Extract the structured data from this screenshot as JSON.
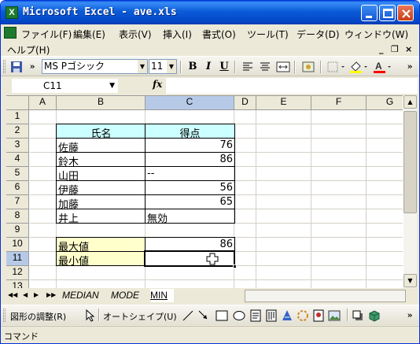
{
  "window": {
    "title": "Microsoft Excel - ave.xls",
    "app_icon_letter": "X"
  },
  "menu": {
    "items": [
      "ファイル(F)",
      "編集(E)",
      "表示(V)",
      "挿入(I)",
      "書式(O)",
      "ツール(T)",
      "データ(D)",
      "ウィンドウ(W)",
      "ヘルプ(H)"
    ],
    "doc_controls": [
      "_",
      "❐",
      "×"
    ]
  },
  "toolbar": {
    "font_name": "MS Pゴシック",
    "font_size": "11",
    "bold": "B",
    "italic": "I",
    "underline": "U",
    "more": "»"
  },
  "formula_bar": {
    "name_box": "C11",
    "fx": "fx",
    "formula": ""
  },
  "sheet": {
    "columns": [
      "A",
      "B",
      "C",
      "D",
      "E",
      "F",
      "G"
    ],
    "selected_column": "C",
    "rows": [
      "1",
      "2",
      "3",
      "4",
      "5",
      "6",
      "7",
      "8",
      "9",
      "10",
      "11",
      "12",
      "13"
    ],
    "selected_row": "11",
    "header_row": {
      "name": "氏名",
      "score": "得点"
    },
    "records": [
      {
        "name": "佐藤",
        "score": "76"
      },
      {
        "name": "鈴木",
        "score": "86"
      },
      {
        "name": "山田",
        "score": "--"
      },
      {
        "name": "伊藤",
        "score": "56"
      },
      {
        "name": "加藤",
        "score": "65"
      },
      {
        "name": "井上",
        "score": "無効"
      }
    ],
    "summary": [
      {
        "label": "最大値",
        "value": "86"
      },
      {
        "label": "最小値",
        "value": ""
      }
    ],
    "colors": {
      "header_fill": "#ccffff",
      "summary_fill": "#ffffcc",
      "selection": "#000000"
    }
  },
  "tabs": {
    "nav": [
      "◀◀",
      "◀",
      "▶",
      "▶▶"
    ],
    "sheets": [
      "MEDIAN",
      "MODE",
      "MIN"
    ],
    "active": "MIN"
  },
  "drawing": {
    "adjust": "図形の調整(R)",
    "autoshape": "オートシェイプ(U)"
  },
  "status": {
    "text": "コマンド"
  }
}
